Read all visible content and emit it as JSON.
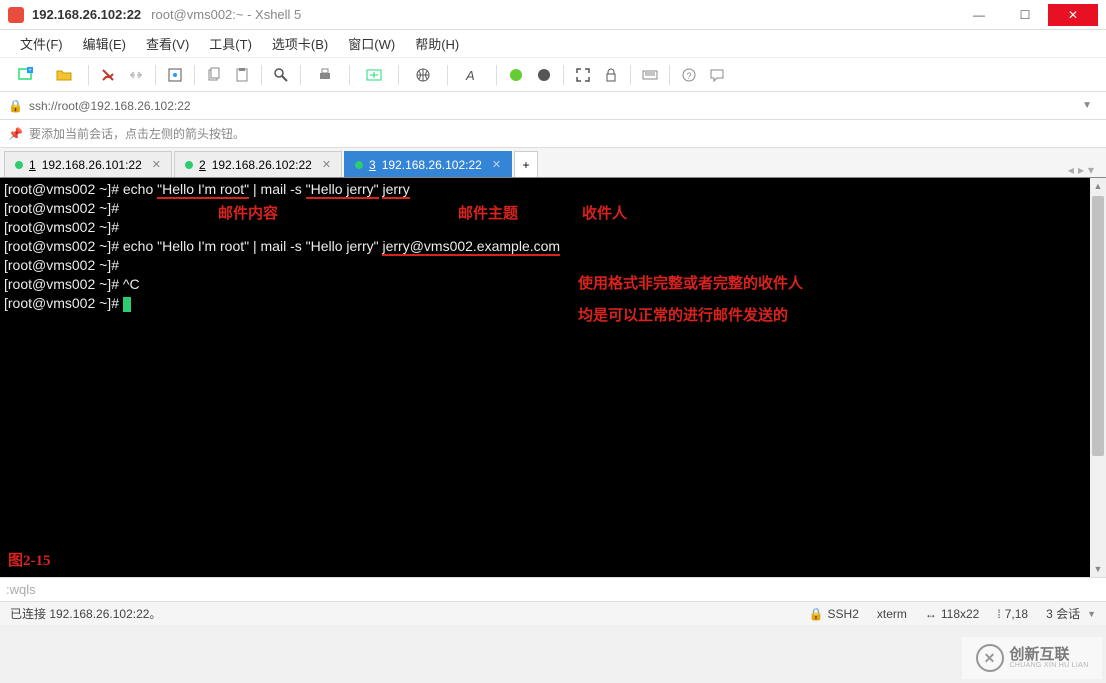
{
  "title": {
    "host": "192.168.26.102:22",
    "suffix": "root@vms002:~ - Xshell 5"
  },
  "menu": {
    "file": "文件(F)",
    "edit": "编辑(E)",
    "view": "查看(V)",
    "tools": "工具(T)",
    "tabs": "选项卡(B)",
    "window": "窗口(W)",
    "help": "帮助(H)"
  },
  "address": "ssh://root@192.168.26.102:22",
  "hint": "要添加当前会话，点击左侧的箭头按钮。",
  "tabs": [
    {
      "num": "1",
      "label": "192.168.26.101:22"
    },
    {
      "num": "2",
      "label": "192.168.26.102:22"
    },
    {
      "num": "3",
      "label": "192.168.26.102:22"
    }
  ],
  "term": {
    "l1a": "[root@vms002 ~]# echo ",
    "l1b": "\"Hello I'm root\"",
    "l1c": " | mail -s ",
    "l1d": "\"Hello jerry\"",
    "l1e": " ",
    "l1f": "jerry",
    "l2": "[root@vms002 ~]# ",
    "l3": "[root@vms002 ~]# ",
    "l4a": "[root@vms002 ~]# echo \"Hello I'm root\" | mail -s \"Hello jerry\" ",
    "l4b": "jerry@vms002.example.com",
    "l5": "[root@vms002 ~]# ",
    "l6": "[root@vms002 ~]# ^C",
    "l7": "[root@vms002 ~]# "
  },
  "annotations": {
    "mail_content": "邮件内容",
    "mail_subject": "邮件主题",
    "recipient": "收件人",
    "note1": "使用格式非完整或者完整的收件人",
    "note2": "均是可以正常的进行邮件发送的",
    "figure": "图2-15"
  },
  "inputbar": ":wqls",
  "status": {
    "connected": "已连接 192.168.26.102:22。",
    "ssh": "SSH2",
    "term": "xterm",
    "size": "118x22",
    "pos": "7,18",
    "sessions": "3 会话"
  },
  "watermark": {
    "text": "创新互联",
    "sub": "CHUANG XIN HU LIAN"
  },
  "icons": {
    "lock": "🔒",
    "pin": "📌",
    "sizeicon": "↔",
    "posicon": "⁞"
  }
}
